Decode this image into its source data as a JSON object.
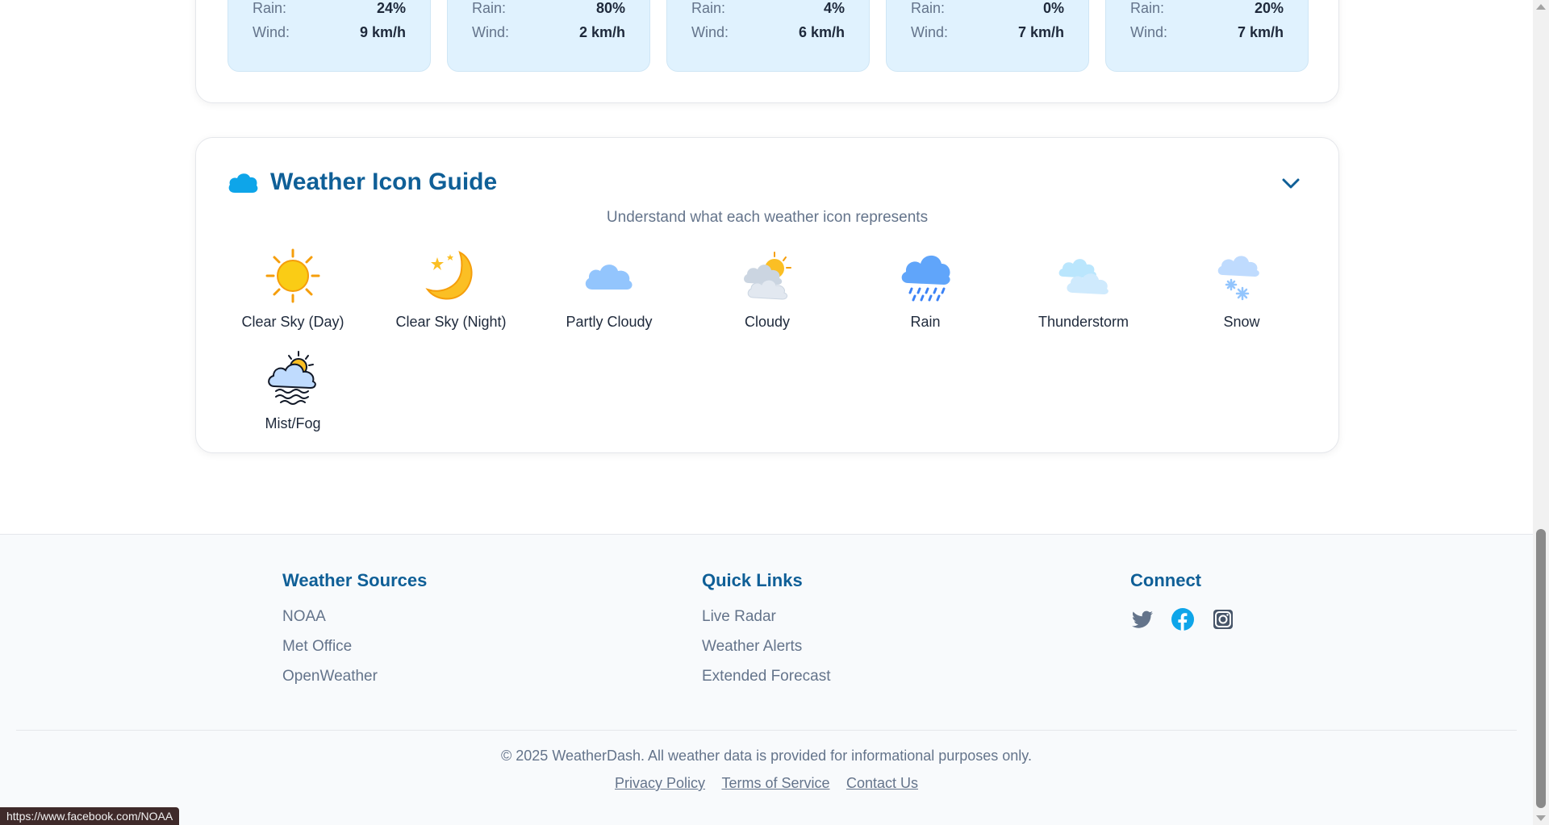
{
  "forecast": {
    "days": [
      {
        "rain_label": "Rain:",
        "rain": "24%",
        "wind_label": "Wind:",
        "wind": "9 km/h"
      },
      {
        "rain_label": "Rain:",
        "rain": "80%",
        "wind_label": "Wind:",
        "wind": "2 km/h"
      },
      {
        "rain_label": "Rain:",
        "rain": "4%",
        "wind_label": "Wind:",
        "wind": "6 km/h"
      },
      {
        "rain_label": "Rain:",
        "rain": "0%",
        "wind_label": "Wind:",
        "wind": "7 km/h"
      },
      {
        "rain_label": "Rain:",
        "rain": "20%",
        "wind_label": "Wind:",
        "wind": "7 km/h"
      }
    ]
  },
  "guide": {
    "title": "Weather Icon Guide",
    "subtitle": "Understand what each weather icon represents",
    "title_icon": "cloud-icon",
    "toggle_icon": "chevron-down-icon",
    "items": [
      {
        "label": "Clear Sky (Day)",
        "icon": "sun-icon"
      },
      {
        "label": "Clear Sky (Night)",
        "icon": "moon-stars-icon"
      },
      {
        "label": "Partly Cloudy",
        "icon": "cloud-icon"
      },
      {
        "label": "Cloudy",
        "icon": "sun-behind-clouds-icon"
      },
      {
        "label": "Rain",
        "icon": "rain-cloud-icon"
      },
      {
        "label": "Thunderstorm",
        "icon": "storm-clouds-icon"
      },
      {
        "label": "Snow",
        "icon": "snow-cloud-icon"
      },
      {
        "label": "Mist/Fog",
        "icon": "fog-icon"
      }
    ]
  },
  "footer": {
    "sources": {
      "title": "Weather Sources",
      "links": [
        "NOAA",
        "Met Office",
        "OpenWeather"
      ]
    },
    "quick_links": {
      "title": "Quick Links",
      "links": [
        "Live Radar",
        "Weather Alerts",
        "Extended Forecast"
      ]
    },
    "connect": {
      "title": "Connect",
      "icons": [
        "twitter-icon",
        "facebook-icon",
        "instagram-icon"
      ]
    },
    "copyright": "© 2025 WeatherDash. All weather data is provided for informational purposes only.",
    "legal": [
      "Privacy Policy",
      "Terms of Service",
      "Contact Us"
    ]
  },
  "status_bar": {
    "url": "https://www.facebook.com/NOAA"
  },
  "colors": {
    "accent": "#0f5f97",
    "card_bg": "#e0f2fe",
    "muted_text": "#64748b"
  }
}
